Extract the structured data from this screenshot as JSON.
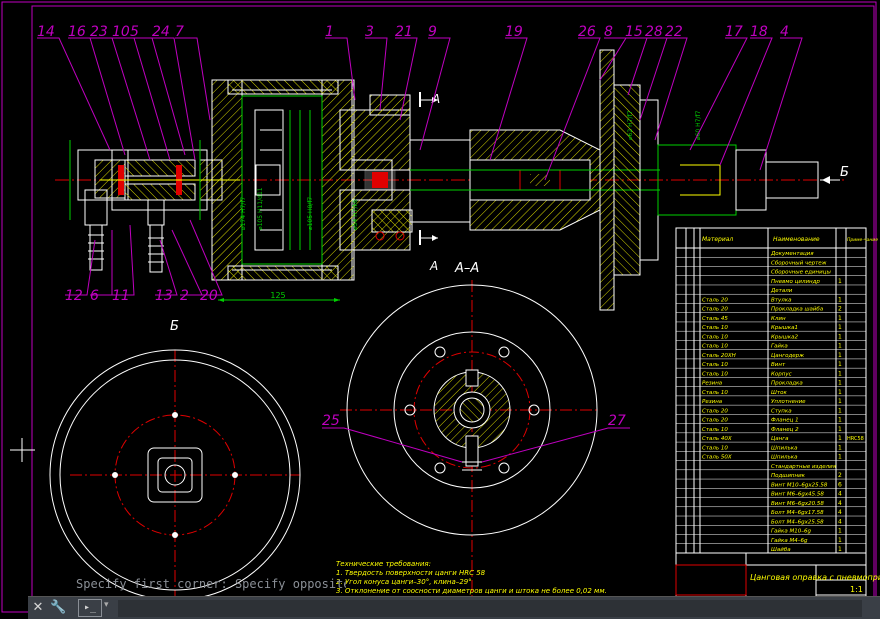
{
  "drawing": {
    "balloons": [
      "14",
      "16",
      "23",
      "10",
      "5",
      "24",
      "7",
      "1",
      "3",
      "21",
      "9",
      "19",
      "26",
      "8",
      "15",
      "28",
      "22",
      "17",
      "18",
      "4"
    ],
    "bottom_balloons": [
      "12",
      "6",
      "11",
      "13",
      "2",
      "20"
    ],
    "section_label_top": "А",
    "section_label_bottom": "А",
    "section_title": "А–А",
    "view_b_label": "Б",
    "arrow_b_label": "Б",
    "label_25": "25",
    "label_27": "27",
    "dim_125": "125"
  },
  "tech_requirements": {
    "title": "Технические требования:",
    "lines": [
      "1. Твердость поверхности цанги HRC 58",
      "2. Угол конуса цанги–30°, клина–29°",
      "3. Отклонение от соосности диаметров цанги и штока не более 0,02 мм."
    ]
  },
  "spec_table": {
    "header": {
      "material": "Материал",
      "name": "Наименование",
      "note": "Приме-чание"
    },
    "rows": [
      {
        "mat": "",
        "name": "Документация",
        "qty": "",
        "note": ""
      },
      {
        "mat": "",
        "name": "Сборочный чертеж",
        "qty": "",
        "note": ""
      },
      {
        "mat": "",
        "name": "Сборочные единицы",
        "qty": "",
        "note": ""
      },
      {
        "mat": "",
        "name": "Пневмо цилиндр",
        "qty": "1",
        "note": ""
      },
      {
        "mat": "",
        "name": "Детали",
        "qty": "",
        "note": ""
      },
      {
        "mat": "Сталь 20",
        "name": "Втулка",
        "qty": "1",
        "note": ""
      },
      {
        "mat": "Сталь 20",
        "name": "Прокладка шайба",
        "qty": "2",
        "note": ""
      },
      {
        "mat": "Сталь 45",
        "name": "Клин",
        "qty": "1",
        "note": ""
      },
      {
        "mat": "Сталь 10",
        "name": "Крышка1",
        "qty": "1",
        "note": ""
      },
      {
        "mat": "Сталь 10",
        "name": "Крышка2",
        "qty": "1",
        "note": ""
      },
      {
        "mat": "Сталь 10",
        "name": "Гайка",
        "qty": "1",
        "note": ""
      },
      {
        "mat": "Сталь 20ХН",
        "name": "Цангодерж",
        "qty": "1",
        "note": ""
      },
      {
        "mat": "Сталь 10",
        "name": "Винт",
        "qty": "1",
        "note": ""
      },
      {
        "mat": "Сталь 10",
        "name": "Корпус",
        "qty": "1",
        "note": ""
      },
      {
        "mat": "Резина",
        "name": "Прокладка",
        "qty": "1",
        "note": ""
      },
      {
        "mat": "Сталь 10",
        "name": "Шток",
        "qty": "1",
        "note": ""
      },
      {
        "mat": "Резина",
        "name": "Уплотнение",
        "qty": "1",
        "note": ""
      },
      {
        "mat": "Сталь 20",
        "name": "Ступка",
        "qty": "1",
        "note": ""
      },
      {
        "mat": "Сталь 20",
        "name": "Фланец 1",
        "qty": "1",
        "note": ""
      },
      {
        "mat": "Сталь 10",
        "name": "Фланец 2",
        "qty": "1",
        "note": ""
      },
      {
        "mat": "Сталь 40Х",
        "name": "Цанга",
        "qty": "1",
        "note": "HRC58"
      },
      {
        "mat": "Сталь 10",
        "name": "Шпилька",
        "qty": "1",
        "note": ""
      },
      {
        "mat": "Сталь 50Х",
        "name": "Шпилька",
        "qty": "1",
        "note": ""
      },
      {
        "mat": "",
        "name": "Стандартные изделия",
        "qty": "",
        "note": ""
      },
      {
        "mat": "",
        "name": "Подшипник",
        "qty": "2",
        "note": ""
      },
      {
        "mat": "",
        "name": "Винт М10–6gх25.58",
        "qty": "6",
        "note": ""
      },
      {
        "mat": "",
        "name": "Винт М6–6gх45.58",
        "qty": "4",
        "note": ""
      },
      {
        "mat": "",
        "name": "Винт М6–6gх20.58",
        "qty": "4",
        "note": ""
      },
      {
        "mat": "",
        "name": "Болт М4–6gх17.58",
        "qty": "4",
        "note": ""
      },
      {
        "mat": "",
        "name": "Болт М4–6gх25.58",
        "qty": "4",
        "note": ""
      },
      {
        "mat": "",
        "name": "Гайка М10–6g",
        "qty": "1",
        "note": ""
      },
      {
        "mat": "",
        "name": "Гайка М4–6g",
        "qty": "1",
        "note": ""
      },
      {
        "mat": "",
        "name": "Шайба",
        "qty": "1",
        "note": ""
      }
    ]
  },
  "title_block": {
    "name": "Цанговая оправка с пневмоприводом",
    "scale": "1:1",
    "sheet": "1"
  },
  "command": {
    "history": "Specify first corner: Specify opposite",
    "input_value": "",
    "input_placeholder": ""
  },
  "colors": {
    "frame": "#c000c0",
    "geometry": "#ffffff",
    "hatch": "#d8d800",
    "green": "#00d000",
    "center": "#e00000",
    "cyan": "#00c8c8",
    "yellow": "#ffff00"
  }
}
